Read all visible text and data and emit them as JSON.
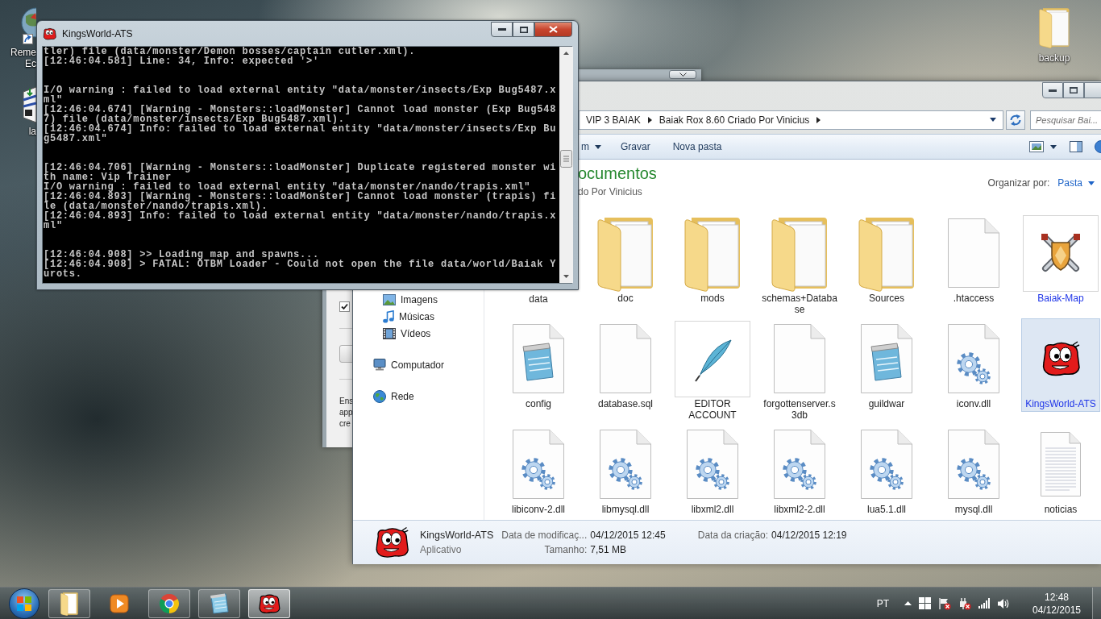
{
  "desktop": {
    "left_icons": [
      {
        "kind": "globe-shortcut",
        "label_lines": [
          "Reme",
          "Ec"
        ]
      },
      {
        "kind": "package-shortcut",
        "label_lines": [
          "la"
        ]
      }
    ],
    "right_icons": [
      {
        "kind": "folder",
        "label_lines": [
          "backup"
        ]
      }
    ]
  },
  "background_window": {
    "checkbox": {
      "checked": true
    },
    "text_lines": [
      "Ens",
      "app",
      "cre"
    ]
  },
  "explorer": {
    "address": {
      "crumbs": [
        "VIP 3 BAIAK",
        "Baiak Rox 8.60 Criado Por Vinicius"
      ]
    },
    "search": {
      "placeholder": "Pesquisar Bai..."
    },
    "toolbar": [
      {
        "label": "m",
        "kind": "menu"
      },
      {
        "label": "Gravar",
        "kind": "button"
      },
      {
        "label": "Nova pasta",
        "kind": "button"
      }
    ],
    "library": {
      "title": "ocumentos",
      "subtitle": "do Por Vinicius",
      "arrange_label": "Organizar por:",
      "arrange_value": "Pasta"
    },
    "nav": [
      {
        "children": [
          {
            "label": "Imagens",
            "kind": "pictures"
          },
          {
            "label": "Músicas",
            "kind": "music"
          },
          {
            "label": "Vídeos",
            "kind": "videos"
          }
        ]
      },
      {
        "label": "Computador",
        "kind": "computer"
      },
      {
        "label": "Rede",
        "kind": "network"
      }
    ],
    "files": [
      {
        "label": "data",
        "selected": false,
        "compressed": false
      },
      {
        "label": "doc",
        "kind": "folder",
        "selected": false,
        "compressed": false
      },
      {
        "label": "mods",
        "kind": "folder",
        "selected": false,
        "compressed": false
      },
      {
        "label": "schemas+Database",
        "kind": "folder",
        "selected": false,
        "compressed": false
      },
      {
        "label": "Sources",
        "kind": "folder",
        "selected": false,
        "compressed": false
      },
      {
        "label": ".htaccess",
        "kind": "blank",
        "selected": false,
        "compressed": false
      },
      {
        "label": "Baiak-Map",
        "kind": "swords-app",
        "selected": false,
        "compressed": true
      },
      {
        "label": "config",
        "kind": "notepad",
        "selected": false,
        "compressed": false
      },
      {
        "label": "database.sql",
        "kind": "blank",
        "selected": false,
        "compressed": false
      },
      {
        "label": "EDITOR ACCOUNT",
        "kind": "quill-app",
        "selected": false,
        "compressed": false
      },
      {
        "label": "forgottenserver.s3db",
        "kind": "blank",
        "selected": false,
        "compressed": false
      },
      {
        "label": "guildwar",
        "kind": "notepad",
        "selected": false,
        "compressed": false
      },
      {
        "label": "iconv.dll",
        "kind": "gears",
        "selected": false,
        "compressed": false
      },
      {
        "label": "KingsWorld-ATS",
        "kind": "creature-app",
        "selected": true,
        "compressed": true
      },
      {
        "label": "libiconv-2.dll",
        "kind": "gears",
        "selected": false,
        "compressed": false
      },
      {
        "label": "libmysql.dll",
        "kind": "gears",
        "selected": false,
        "compressed": false
      },
      {
        "label": "libxml2.dll",
        "kind": "gears",
        "selected": false,
        "compressed": false
      },
      {
        "label": "libxml2-2.dll",
        "kind": "gears",
        "selected": false,
        "compressed": false
      },
      {
        "label": "lua5.1.dll",
        "kind": "gears",
        "selected": false,
        "compressed": false
      },
      {
        "label": "mysql.dll",
        "kind": "gears",
        "selected": false,
        "compressed": false
      },
      {
        "label": "noticias",
        "kind": "text",
        "selected": false,
        "compressed": false
      }
    ],
    "details": {
      "name": "KingsWorld-ATS",
      "type": "Aplicativo",
      "properties": [
        {
          "label": "Data de modificaç...",
          "value": "04/12/2015 12:45"
        },
        {
          "label": "Tamanho:",
          "value": "7,51 MB"
        },
        {
          "label": "Data da criação:",
          "value": "04/12/2015 12:19"
        }
      ]
    }
  },
  "console_window": {
    "title": "KingsWorld-ATS",
    "blocks": [
      {
        "lines": [
          "tler) file (data/monster/Demon bosses/captain cutler.xml).",
          "[12:46:04.581] Line: 34, Info: expected '>'"
        ]
      },
      {
        "lines": [
          "I/O warning : failed to load external entity \"data/monster/insects/Exp Bug5487.xml\"",
          "[12:46:04.674] [Warning - Monsters::loadMonster] Cannot load monster (Exp Bug5487) file (data/monster/insects/Exp Bug5487.xml).",
          "[12:46:04.674] Info: failed to load external entity \"data/monster/insects/Exp Bug5487.xml\""
        ]
      },
      {
        "lines": [
          "[12:46:04.706] [Warning - Monsters::loadMonster] Duplicate registered monster with name: Vip Trainer",
          "I/O warning : failed to load external entity \"data/monster/nando/trapis.xml\"",
          "[12:46:04.893] [Warning - Monsters::loadMonster] Cannot load monster (trapis) file (data/monster/nando/trapis.xml).",
          "[12:46:04.893] Info: failed to load external entity \"data/monster/nando/trapis.xml\""
        ]
      },
      {
        "lines": [
          "[12:46:04.908] >> Loading map and spawns...",
          "[12:46:04.908] > FATAL: OTBM Loader - Could not open the file data/world/Baiak Yurots."
        ]
      }
    ]
  },
  "taskbar": {
    "buttons": [
      {
        "kind": "folder",
        "running": true,
        "selected": false
      },
      {
        "kind": "media",
        "running": false,
        "selected": false
      },
      {
        "kind": "ring",
        "running": true,
        "selected": false
      },
      {
        "kind": "notepad",
        "running": true,
        "selected": false
      },
      {
        "kind": "creature",
        "running": true,
        "selected": true
      }
    ],
    "language": "PT",
    "time": "12:48",
    "date": "04/12/2015"
  }
}
